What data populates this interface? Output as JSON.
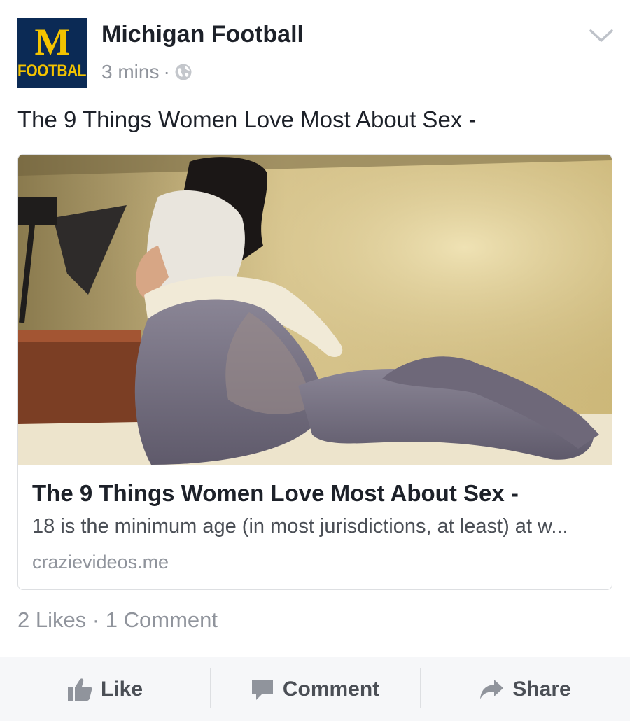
{
  "post": {
    "avatar": {
      "letter": "M",
      "word": "FOOTBALL",
      "bg_color": "#0b2a55",
      "text_color": "#f3c300"
    },
    "page_name": "Michigan Football",
    "timestamp": "3 mins",
    "separator": "·",
    "privacy_icon": "globe-icon",
    "menu_icon": "chevron-down-icon",
    "text": "The 9 Things Women Love Most About Sex -"
  },
  "link_preview": {
    "title": "The 9 Things Women Love Most About Sex -",
    "description": "18 is the minimum age (in most jurisdictions, at least) at w...",
    "domain": "crazievideos.me"
  },
  "engagement": {
    "summary": "2 Likes · 1 Comment"
  },
  "actions": {
    "like": "Like",
    "comment": "Comment",
    "share": "Share"
  },
  "colors": {
    "secondary_text": "#90949c",
    "action_text": "#4b4f56",
    "action_bar_bg": "#f6f7f9"
  }
}
